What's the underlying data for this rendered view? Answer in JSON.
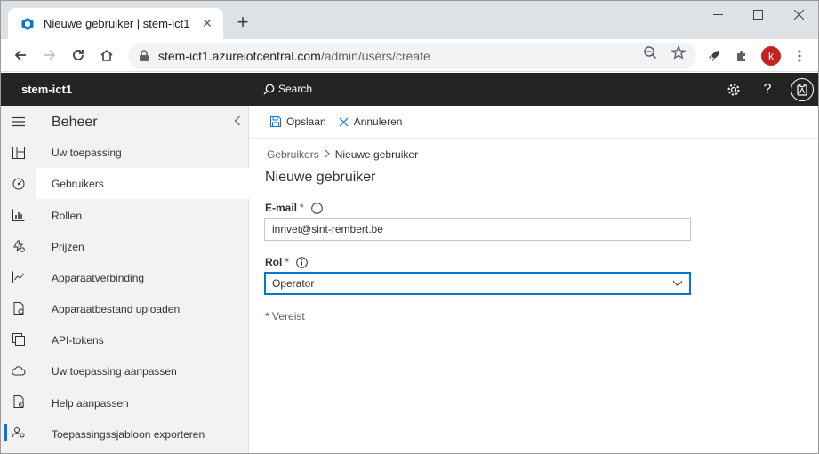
{
  "browser": {
    "tab_title": "Nieuwe gebruiker | stem-ict1",
    "url_host": "stem-ict1.azureiotcentral.com",
    "url_path": "/admin/users/create",
    "profile_initial": "k"
  },
  "app": {
    "name": "stem-ict1",
    "search_label": "Search"
  },
  "sidenav": {
    "title": "Beheer",
    "items": [
      {
        "label": "Uw toepassing"
      },
      {
        "label": "Gebruikers"
      },
      {
        "label": "Rollen"
      },
      {
        "label": "Prijzen"
      },
      {
        "label": "Apparaatverbinding"
      },
      {
        "label": "Apparaatbestand uploaden"
      },
      {
        "label": "API-tokens"
      },
      {
        "label": "Uw toepassing aanpassen"
      },
      {
        "label": "Help aanpassen"
      },
      {
        "label": "Toepassingssjabloon exporteren"
      }
    ]
  },
  "commands": {
    "save": "Opslaan",
    "cancel": "Annuleren"
  },
  "breadcrumb": {
    "parent": "Gebruikers",
    "current": "Nieuwe gebruiker"
  },
  "form": {
    "title": "Nieuwe gebruiker",
    "email_label": "E-mail",
    "email_value": "innvet@sint-rembert.be",
    "role_label": "Rol",
    "role_value": "Operator",
    "required_star": "*",
    "required_note": "Vereist"
  },
  "colors": {
    "accent": "#0078d4",
    "header_bg": "#252423",
    "required": "#a4262c"
  }
}
